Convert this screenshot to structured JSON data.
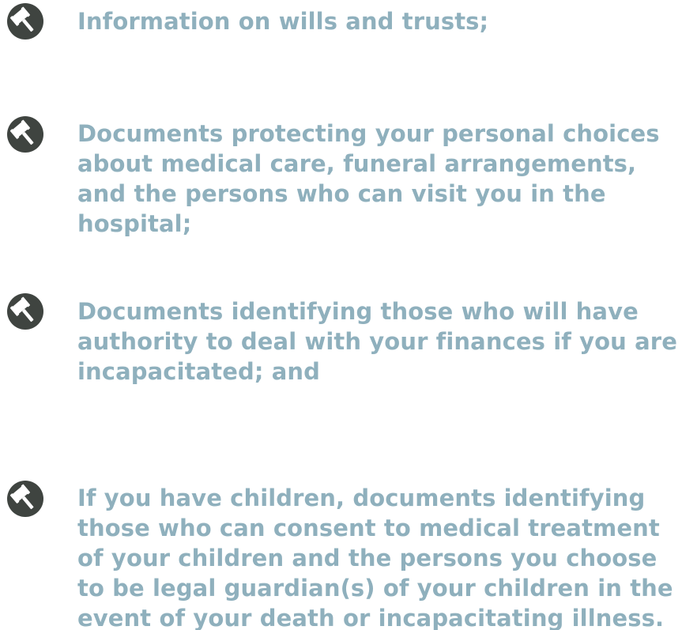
{
  "colors": {
    "text": "#8fb0bd",
    "icon_background": "#3f4440",
    "icon_glyph": "#ffffff"
  },
  "bullet_icon": "gavel-icon",
  "items": [
    {
      "text": "Information on wills and trusts;"
    },
    {
      "text": "Documents protecting your personal choices about medical care, funeral arrangements, and the persons who can visit you in the hospital;"
    },
    {
      "text": "Documents identifying those who will have authority to deal with your finances if you are incapacitated; and"
    },
    {
      "text": "If you have children, documents identifying those who can consent to medical treatment of your children and the persons you choose to be legal guardian(s) of your children in the event of your death or incapacitating illness."
    }
  ]
}
